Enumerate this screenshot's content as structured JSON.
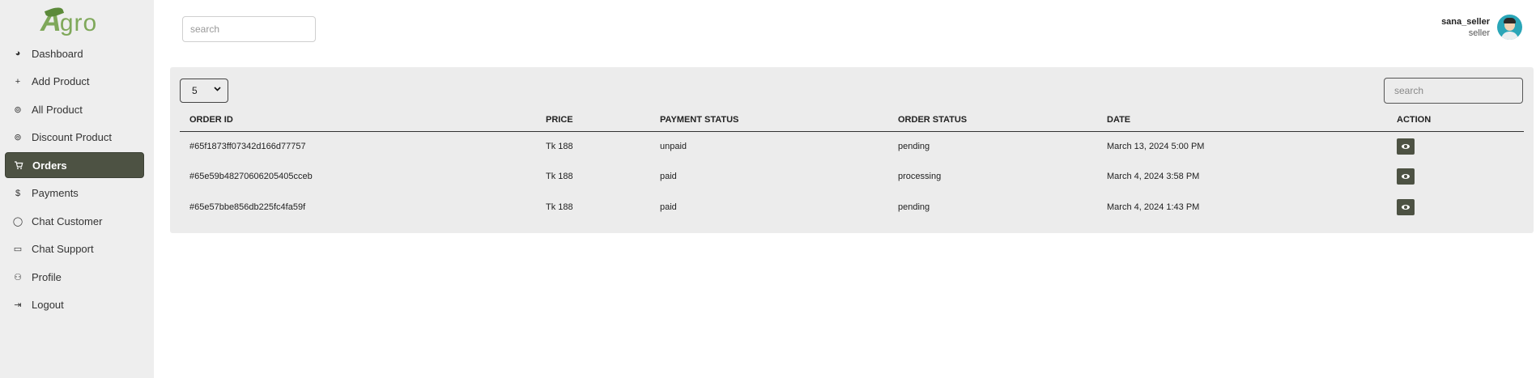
{
  "brand": {
    "logo_letter": "A",
    "logo_rest": "gro"
  },
  "sidebar": {
    "items": [
      {
        "label": "Dashboard",
        "icon": "dashboard-icon",
        "glyph": "◕"
      },
      {
        "label": "Add Product",
        "icon": "plus-icon",
        "glyph": "+"
      },
      {
        "label": "All Product",
        "icon": "product-icon",
        "glyph": "⊚"
      },
      {
        "label": "Discount Product",
        "icon": "discount-icon",
        "glyph": "⊚"
      },
      {
        "label": "Orders",
        "icon": "cart-icon",
        "glyph": "🛒",
        "active": true
      },
      {
        "label": "Payments",
        "icon": "dollar-icon",
        "glyph": "$"
      },
      {
        "label": "Chat Customer",
        "icon": "chat-bubble-icon",
        "glyph": "◯"
      },
      {
        "label": "Chat Support",
        "icon": "message-square-icon",
        "glyph": "▭"
      },
      {
        "label": "Profile",
        "icon": "users-icon",
        "glyph": "⚇"
      },
      {
        "label": "Logout",
        "icon": "logout-icon",
        "glyph": "⇥"
      }
    ]
  },
  "header": {
    "search_placeholder": "search",
    "user_name": "sana_seller",
    "user_role": "seller"
  },
  "orders": {
    "page_size": "5",
    "search_placeholder": "search",
    "columns": [
      "ORDER ID",
      "PRICE",
      "PAYMENT STATUS",
      "ORDER STATUS",
      "DATE",
      "ACTION"
    ],
    "rows": [
      {
        "order_id": "#65f1873ff07342d166d77757",
        "price": "Tk 188",
        "payment_status": "unpaid",
        "order_status": "pending",
        "date": "March 13, 2024 5:00 PM"
      },
      {
        "order_id": "#65e59b48270606205405cceb",
        "price": "Tk 188",
        "payment_status": "paid",
        "order_status": "processing",
        "date": "March 4, 2024 3:58 PM"
      },
      {
        "order_id": "#65e57bbe856db225fc4fa59f",
        "price": "Tk 188",
        "payment_status": "paid",
        "order_status": "pending",
        "date": "March 4, 2024 1:43 PM"
      }
    ]
  },
  "colors": {
    "accent": "#4d5243",
    "brand_green": "#7fa85a",
    "sidebar_bg": "#eeeeee",
    "panel_bg": "#ececec"
  }
}
